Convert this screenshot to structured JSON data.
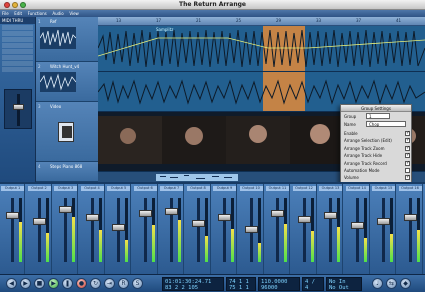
{
  "window": {
    "title": "The Return Arrange"
  },
  "menubar": {
    "items": [
      "File",
      "Edit",
      "Functions",
      "Audio",
      "View"
    ]
  },
  "inspector": {
    "title": "MIDI THRU"
  },
  "ruler": {
    "marks": [
      "13",
      "17",
      "21",
      "25",
      "29",
      "33",
      "37",
      "41"
    ]
  },
  "tracks": [
    {
      "num": "1",
      "name": "Ref"
    },
    {
      "num": "2",
      "name": "Witch Hunt_v4"
    },
    {
      "num": "3",
      "name": "Video"
    },
    {
      "num": "4",
      "name": "Steps Piano 868"
    }
  ],
  "regions": {
    "audio1": "Samplitz",
    "video_group": "Group Settings"
  },
  "group_panel": {
    "title": "Group Settings",
    "group_label": "Group",
    "group_value": "1",
    "name_label": "Name",
    "name_value": "Chop",
    "rows": [
      {
        "label": "Enable",
        "checked": true
      },
      {
        "label": "Arrange Selection (Edit)",
        "checked": true
      },
      {
        "label": "Arrange Track Zoom",
        "checked": true
      },
      {
        "label": "Arrange Track Hide",
        "checked": true
      },
      {
        "label": "Arrange Track Record",
        "checked": true
      },
      {
        "label": "Automation Mode",
        "checked": false
      },
      {
        "label": "Volume",
        "checked": true
      },
      {
        "label": "Mute",
        "checked": true
      },
      {
        "label": "Pan",
        "checked": false
      },
      {
        "label": "Surround",
        "checked": false
      },
      {
        "label": "Send 1",
        "checked": false
      },
      {
        "label": "Send 2",
        "checked": false
      },
      {
        "label": "Send 3",
        "checked": false
      },
      {
        "label": "Send 4",
        "checked": false
      },
      {
        "label": "Send 5",
        "checked": false
      },
      {
        "label": "Send 6",
        "checked": false
      },
      {
        "label": "Send 7",
        "checked": false
      },
      {
        "label": "Send 8",
        "checked": false
      }
    ]
  },
  "mixer": {
    "channel_labels": [
      "Output 1",
      "Output 2",
      "Output 3",
      "Output 4",
      "Output 5",
      "Output 6",
      "Output 7",
      "Output 8",
      "Output 9",
      "Output 10",
      "Output 11",
      "Output 12",
      "Output 13",
      "Output 14",
      "Output 15",
      "Output 16"
    ]
  },
  "transport": {
    "position_time": "01:01:30:24.71",
    "position_sub": "83   2   2   105",
    "bar_a": "74   1   1",
    "bar_b": "75   1   1",
    "tempo": "110.0000",
    "meter": "4 / 4",
    "sample_rate": "96000",
    "tempo_sub": "No In",
    "rec_state": "No Out"
  }
}
